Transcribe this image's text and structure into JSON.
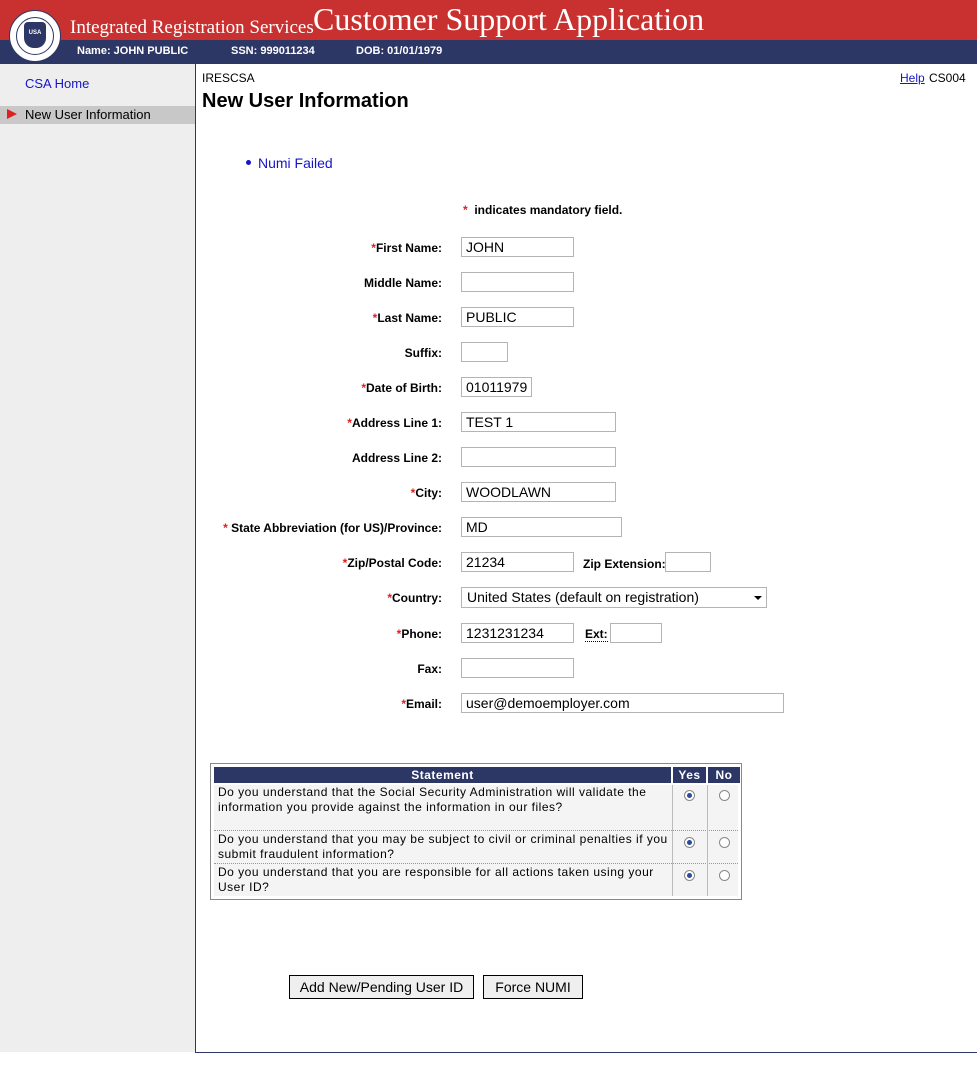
{
  "header": {
    "logo_text": "USA",
    "agency_title": "Integrated Registration Services",
    "app_title": "Customer Support Application",
    "name_info": "Name: JOHN PUBLIC",
    "ssn_info": "SSN: 999011234",
    "dob_info": "DOB: 01/01/1979"
  },
  "sidebar": {
    "home": "CSA Home",
    "current": "New User Information"
  },
  "page": {
    "system_id": "IRESCSA",
    "help": "Help",
    "screen_id": "CS004",
    "title": "New User Information",
    "message": "Numi Failed",
    "mandatory_star": "*",
    "mandatory_note": "indicates mandatory field."
  },
  "form": {
    "first_name": {
      "label": "First Name:",
      "value": "JOHN"
    },
    "middle_name": {
      "label": "Middle Name:",
      "value": ""
    },
    "last_name": {
      "label": "Last Name:",
      "value": "PUBLIC"
    },
    "suffix": {
      "label": "Suffix:",
      "value": ""
    },
    "dob": {
      "label": "Date of Birth:",
      "value": "01011979"
    },
    "address1": {
      "label": "Address Line 1:",
      "value": "TEST 1"
    },
    "address2": {
      "label": "Address Line 2:",
      "value": ""
    },
    "city": {
      "label": "City:",
      "value": "WOODLAWN"
    },
    "state": {
      "label": "State Abbreviation (for US)/Province:",
      "value": "MD"
    },
    "zip": {
      "label": "Zip/Postal Code:",
      "value": "21234"
    },
    "zip_ext": {
      "label": "Zip Extension:",
      "value": ""
    },
    "country": {
      "label": "Country:",
      "value": "United States (default on registration)"
    },
    "phone": {
      "label": "Phone:",
      "value": "1231231234"
    },
    "phone_ext": {
      "label": "Ext:",
      "value": ""
    },
    "fax": {
      "label": "Fax:",
      "value": ""
    },
    "email": {
      "label": "Email:",
      "value": "user@demoemployer.com"
    }
  },
  "statements": {
    "header_statement": "Statement",
    "header_yes": "Yes",
    "header_no": "No",
    "rows": [
      {
        "text": "Do you understand that the Social Security Administration will validate the information you provide against the information in our files?",
        "answer": "yes"
      },
      {
        "text": "Do you understand that you may be subject to civil or criminal penalties if you submit fraudulent information?",
        "answer": "yes"
      },
      {
        "text": "Do you understand that you are responsible for all actions taken using your User ID?",
        "answer": "yes"
      }
    ]
  },
  "buttons": {
    "add": "Add New/Pending User ID",
    "force": "Force NUMI"
  },
  "colors": {
    "header_red": "#c8312f",
    "header_navy": "#2d3766",
    "link_blue": "#1515c8",
    "required_red": "#e0201f"
  }
}
